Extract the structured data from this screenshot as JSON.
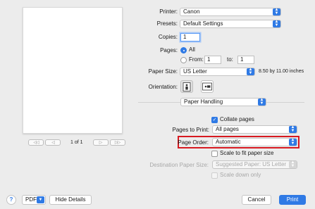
{
  "preview": {
    "first_btn": "◁◁",
    "prev_btn": "◁",
    "page_of": "1 of 1",
    "next_btn": "▷",
    "last_btn": "▷▷"
  },
  "printer": {
    "label": "Printer:",
    "value": "Canon"
  },
  "presets": {
    "label": "Presets:",
    "value": "Default Settings"
  },
  "copies": {
    "label": "Copies:",
    "value": "1"
  },
  "pages": {
    "label": "Pages:",
    "all_label": "All",
    "from_label": "From:",
    "from_value": "1",
    "to_label": "to:",
    "to_value": "1"
  },
  "paper_size": {
    "label": "Paper Size:",
    "value": "US Letter",
    "dims": "8.50 by 11.00 inches"
  },
  "orientation": {
    "label": "Orientation:"
  },
  "section": {
    "value": "Paper Handling"
  },
  "collate": {
    "label": "Collate pages"
  },
  "pages_to_print": {
    "label": "Pages to Print:",
    "value": "All pages"
  },
  "page_order": {
    "label": "Page Order:",
    "value": "Automatic"
  },
  "scale_fit": {
    "label": "Scale to fit paper size"
  },
  "dest_paper": {
    "label": "Destination Paper Size:",
    "value": "Suggested Paper: US Letter"
  },
  "scale_down": {
    "label": "Scale down only"
  },
  "footer": {
    "help": "?",
    "pdf": "PDF",
    "hide_details": "Hide Details",
    "cancel": "Cancel",
    "print": "Print"
  },
  "colors": {
    "accent": "#2f7ae5",
    "highlight": "#d71920"
  }
}
